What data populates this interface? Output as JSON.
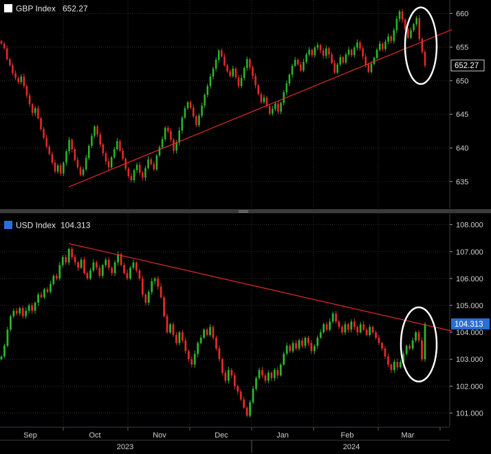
{
  "chart_data": [
    {
      "type": "candlestick",
      "legend": {
        "name": "GBP Index",
        "value": "652.27",
        "color": "#ffffff"
      },
      "last_price_label": "652.27",
      "ylim": [
        631,
        662
      ],
      "yticks": [
        "660",
        "655",
        "650",
        "645",
        "640",
        "635"
      ],
      "ytick_values": [
        660,
        655,
        650,
        645,
        640,
        635
      ],
      "closes": [
        655.5,
        654.8,
        653.2,
        652.3,
        651.1,
        650.4,
        649.8,
        650.6,
        649.2,
        647.8,
        646.5,
        645.2,
        645.9,
        644.4,
        642.8,
        641.5,
        640.2,
        639.1,
        637.8,
        636.5,
        637.4,
        636.2,
        637.8,
        639.5,
        641.2,
        639.8,
        638.2,
        637.1,
        636.0,
        636.8,
        638.5,
        640.3,
        641.8,
        643.2,
        642.0,
        640.5,
        639.2,
        638.0,
        637.1,
        638.6,
        639.8,
        641.0,
        639.6,
        638.4,
        636.9,
        635.8,
        635.2,
        636.7,
        637.5,
        636.3,
        635.6,
        637.0,
        638.3,
        637.6,
        636.8,
        638.9,
        640.1,
        641.3,
        643.0,
        642.5,
        641.2,
        639.6,
        640.8,
        642.6,
        644.5,
        645.9,
        646.8,
        646.0,
        644.7,
        643.4,
        644.8,
        646.3,
        647.9,
        649.2,
        650.6,
        651.8,
        653.1,
        654.5,
        653.6,
        652.3,
        651.4,
        650.7,
        651.8,
        650.5,
        649.2,
        650.4,
        651.9,
        653.2,
        652.0,
        650.7,
        649.3,
        648.0,
        646.8,
        647.5,
        646.2,
        645.1,
        645.8,
        646.6,
        645.4,
        646.7,
        648.3,
        649.6,
        650.9,
        652.2,
        653.1,
        652.4,
        651.5,
        652.8,
        653.9,
        654.6,
        653.8,
        654.9,
        655.3,
        654.5,
        653.7,
        654.8,
        653.9,
        652.6,
        651.2,
        652.4,
        653.5,
        652.7,
        653.9,
        654.6,
        653.8,
        654.9,
        655.7,
        654.8,
        653.6,
        652.4,
        651.3,
        652.5,
        653.4,
        654.6,
        655.5,
        654.7,
        655.8,
        656.6,
        655.9,
        657.5,
        659.2,
        660.3,
        659.1,
        657.6,
        656.4,
        657.5,
        658.4,
        659.3,
        656.2,
        654.3,
        652.27
      ],
      "trendline": {
        "from": [
          100,
          634.2
        ],
        "to": [
          657,
          657.6
        ]
      },
      "highlight": {
        "cx": 612,
        "cy": 655.2,
        "rx": 23,
        "ry": 5.7
      }
    },
    {
      "type": "candlestick",
      "legend": {
        "name": "USD Index",
        "value": "104.313",
        "color": "#2a6fd6"
      },
      "last_price_label": "104.313",
      "ylim": [
        100.5,
        108.4
      ],
      "yticks": [
        "108.000",
        "107.000",
        "106.000",
        "105.000",
        "104.000",
        "103.000",
        "102.000",
        "101.000"
      ],
      "ytick_values": [
        108,
        107,
        106,
        105,
        104,
        103,
        102,
        101
      ],
      "closes": [
        103.1,
        103.5,
        104.1,
        104.6,
        104.8,
        104.7,
        104.9,
        104.6,
        104.8,
        105.0,
        104.8,
        105.1,
        105.4,
        105.3,
        105.6,
        105.5,
        105.8,
        106.1,
        106.0,
        106.5,
        106.8,
        106.6,
        107.1,
        106.8,
        106.6,
        106.4,
        106.7,
        106.2,
        106.0,
        106.3,
        106.6,
        106.4,
        106.1,
        106.5,
        106.7,
        106.4,
        106.2,
        106.6,
        106.9,
        106.5,
        106.2,
        106.0,
        106.4,
        106.6,
        106.3,
        106.0,
        105.4,
        105.1,
        105.5,
        105.9,
        106.0,
        105.7,
        105.3,
        104.6,
        104.0,
        104.3,
        103.9,
        103.6,
        104.0,
        103.7,
        103.3,
        103.0,
        102.8,
        103.2,
        103.6,
        103.8,
        104.1,
        103.9,
        104.2,
        103.8,
        103.4,
        103.0,
        102.5,
        102.2,
        102.6,
        102.4,
        102.0,
        101.8,
        101.5,
        101.2,
        100.9,
        101.4,
        101.9,
        102.3,
        102.6,
        102.4,
        102.2,
        102.5,
        102.3,
        102.6,
        102.4,
        102.8,
        103.2,
        103.5,
        103.3,
        103.6,
        103.4,
        103.7,
        103.5,
        103.8,
        103.6,
        103.3,
        103.5,
        103.8,
        104.0,
        104.3,
        104.1,
        104.4,
        104.7,
        104.4,
        104.2,
        104.0,
        104.3,
        104.1,
        104.4,
        104.2,
        104.0,
        104.3,
        104.1,
        103.9,
        104.2,
        104.0,
        103.8,
        103.6,
        103.4,
        103.1,
        102.8,
        102.6,
        102.9,
        102.7,
        102.9,
        103.2,
        103.5,
        103.4,
        103.7,
        104.0,
        103.7,
        103.0,
        104.313
      ],
      "trendline": {
        "from": [
          100,
          107.3
        ],
        "to": [
          657,
          104.05
        ]
      },
      "highlight": {
        "cx": 609,
        "cy": 103.55,
        "rx": 26,
        "ry": 1.38
      }
    }
  ],
  "x_axis": {
    "months": [
      "Sep",
      "Oct",
      "Nov",
      "Dec",
      "Jan",
      "Feb",
      "Mar"
    ],
    "years": [
      "2023",
      "2024"
    ]
  },
  "colors": {
    "up": "#2db52d",
    "down": "#e52a2a",
    "trendline": "#e52a2a",
    "grid": "#2a2f36",
    "background": "#000000",
    "axis_bg": "#000000",
    "label_box": "#2a6fd6",
    "highlight": "#ffffff"
  }
}
